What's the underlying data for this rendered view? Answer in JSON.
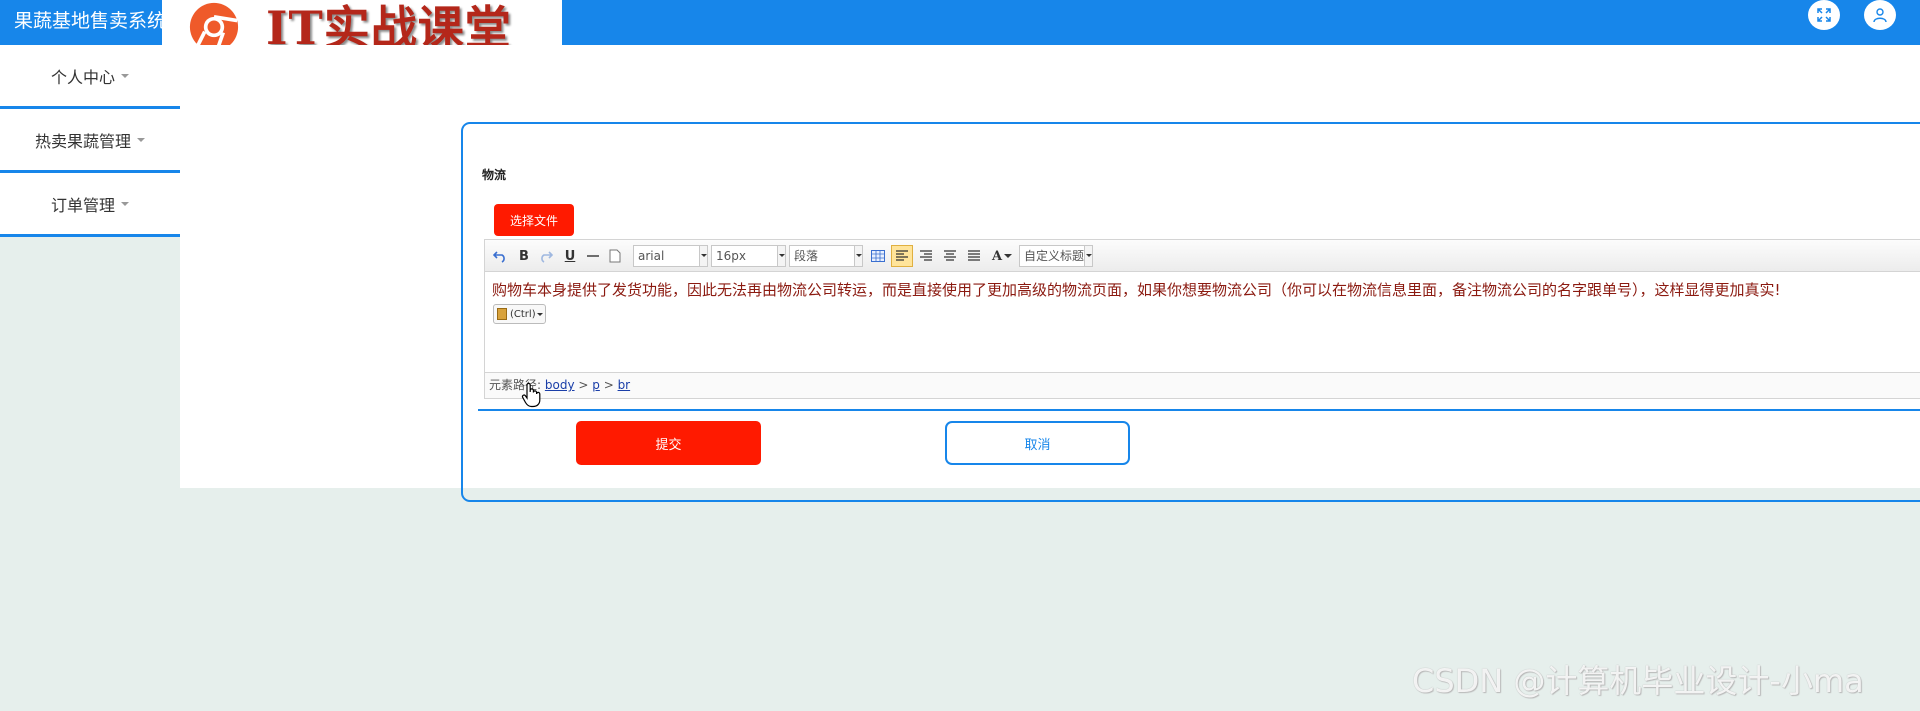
{
  "app": {
    "title": "果蔬基地售卖系统",
    "logo_text": "IT实战课堂"
  },
  "header": {
    "icons": [
      "fullscreen-icon",
      "user-icon"
    ]
  },
  "sidebar": {
    "items": [
      {
        "label": "个人中心"
      },
      {
        "label": "热卖果蔬管理"
      },
      {
        "label": "订单管理"
      }
    ]
  },
  "form": {
    "field_label": "物流",
    "choose_file_label": "选择文件",
    "editor": {
      "font_family": "arial",
      "font_size": "16px",
      "paragraph": "段落",
      "custom_heading": "自定义标题",
      "content": "购物车本身提供了发货功能，因此无法再由物流公司转运，而是直接使用了更加高级的物流页面，如果你想要物流公司（你可以在物流信息里面，备注物流公司的名字跟单号），这样显得更加真实!",
      "paste_label": "(Ctrl)",
      "path_label": "元素路径:",
      "path": [
        "body",
        "p",
        "br"
      ]
    },
    "submit_label": "提交",
    "cancel_label": "取消"
  },
  "watermark": "CSDN @计算机毕业设计-小ma",
  "colors": {
    "primary": "#1786ea",
    "danger": "#ff1a00",
    "page_bg": "#e6efec",
    "editor_text": "#8b1a10"
  }
}
